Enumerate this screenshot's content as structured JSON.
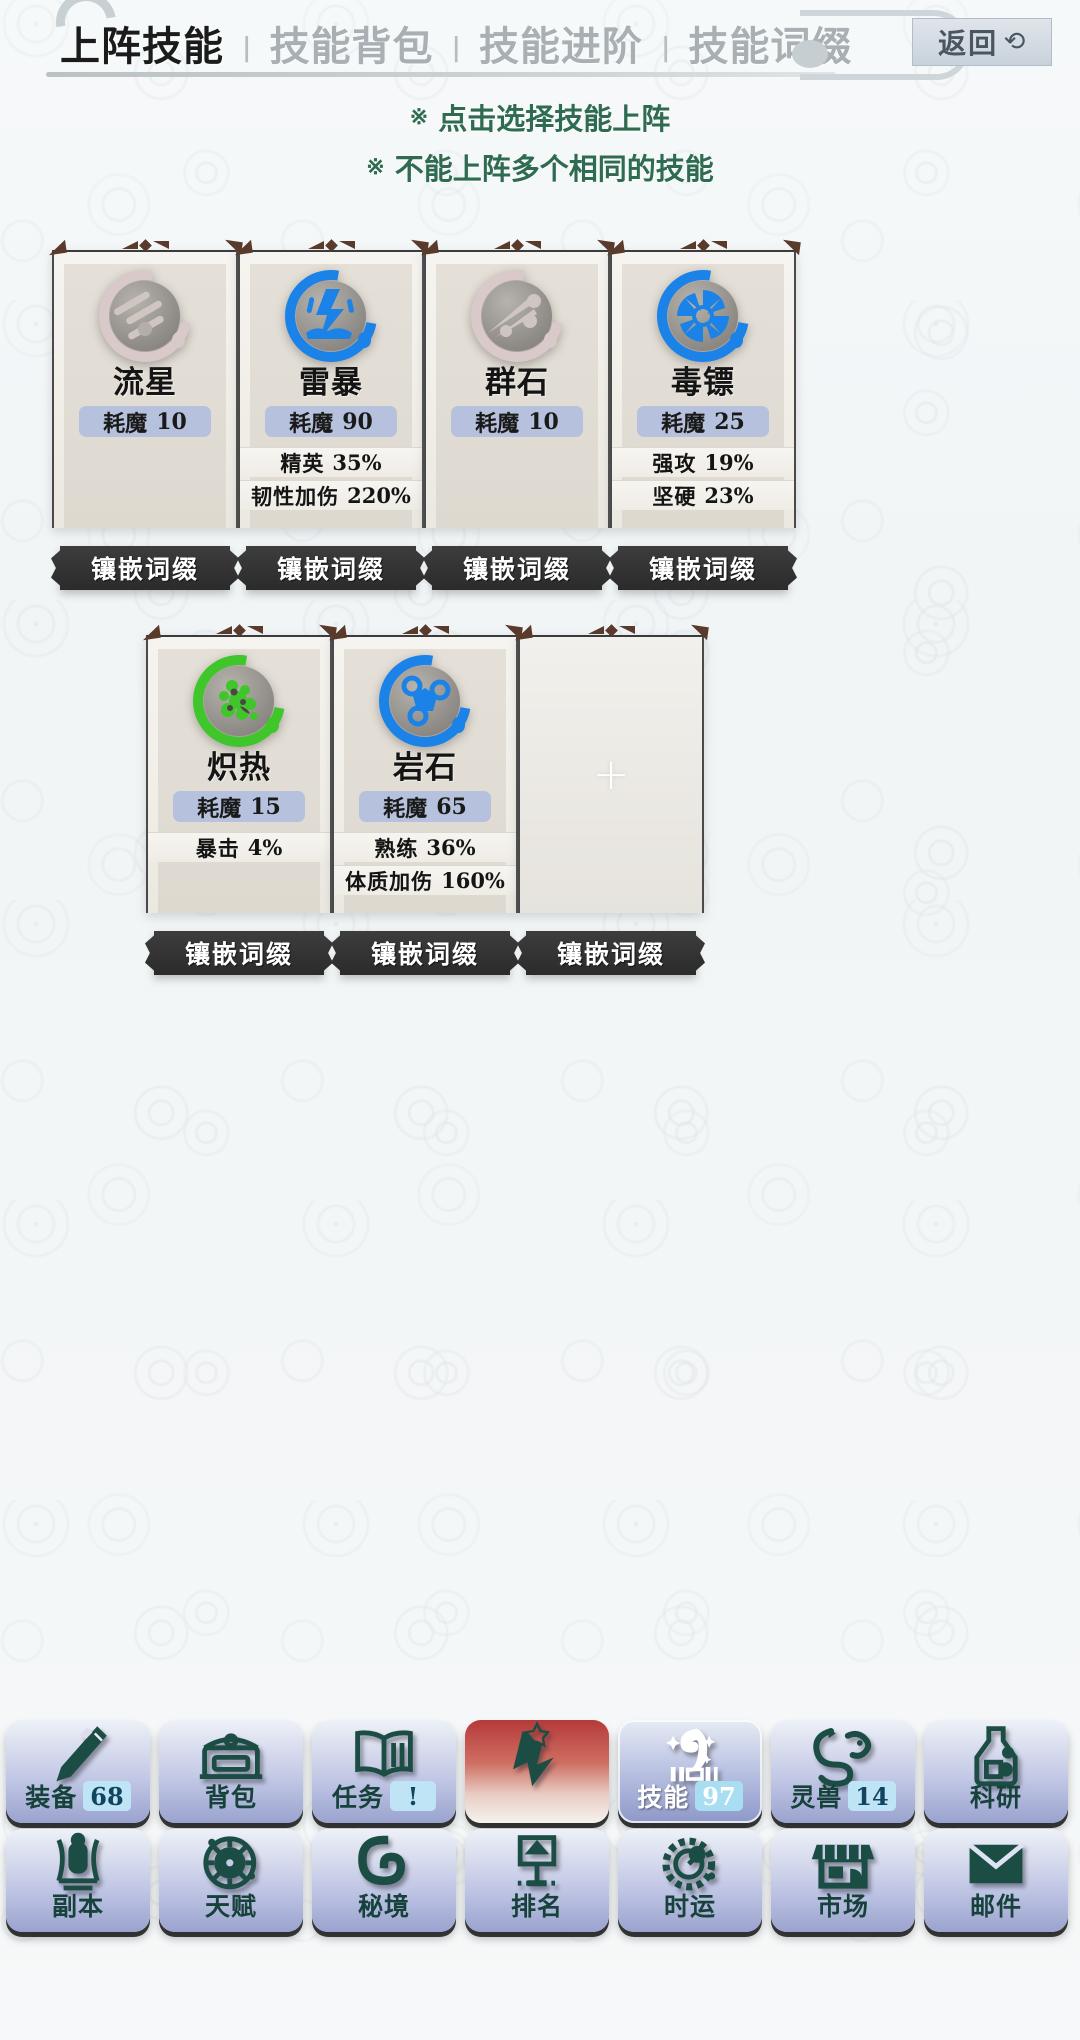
{
  "header": {
    "tabs": [
      {
        "label": "上阵技能",
        "active": true
      },
      {
        "label": "技能背包",
        "active": false
      },
      {
        "label": "技能进阶",
        "active": false
      },
      {
        "label": "技能词缀",
        "active": false
      }
    ],
    "separator": "|",
    "back_button": {
      "label": "返回",
      "icon": "back-arrow-icon",
      "glyph": "⟳"
    }
  },
  "hints": [
    {
      "mark": "※",
      "text": "点击选择技能上阵"
    },
    {
      "mark": "※",
      "text": "不能上阵多个相同的技能"
    }
  ],
  "affix_button_label": "镶嵌词缀",
  "mp_label": "耗魔",
  "empty_slot_glyph": "+",
  "colors": {
    "ring_blue": "#1b82e8",
    "ring_green": "#3fc62b",
    "ring_grey": "#d9c9c9",
    "mp_pill": "#b6c2dd",
    "hint_green": "#2e6b50",
    "nav_icon": "#1b4d45",
    "badge_bg": "#bfe4f5"
  },
  "skills": [
    {
      "name": "流星",
      "mp": "10",
      "ring": "grey",
      "icon": "meteor-icon",
      "equipped": false,
      "affixes": []
    },
    {
      "name": "雷暴",
      "mp": "90",
      "ring": "blue",
      "icon": "thunderstorm-icon",
      "equipped": true,
      "affixes": [
        {
          "name": "精英",
          "value": "35%"
        },
        {
          "name": "韧性加伤",
          "value": "220%"
        }
      ]
    },
    {
      "name": "群石",
      "mp": "10",
      "ring": "grey",
      "icon": "stone-cluster-icon",
      "equipped": false,
      "affixes": []
    },
    {
      "name": "毒镖",
      "mp": "25",
      "ring": "blue",
      "icon": "poison-dart-icon",
      "equipped": true,
      "affixes": [
        {
          "name": "强攻",
          "value": "19%"
        },
        {
          "name": "坚硬",
          "value": "23%"
        }
      ]
    },
    {
      "name": "炽热",
      "mp": "15",
      "ring": "green",
      "icon": "scorch-icon",
      "equipped": true,
      "affixes": [
        {
          "name": "暴击",
          "value": "4%"
        }
      ]
    },
    {
      "name": "岩石",
      "mp": "65",
      "ring": "blue",
      "icon": "rock-icon",
      "equipped": true,
      "affixes": [
        {
          "name": "熟练",
          "value": "36%"
        },
        {
          "name": "体质加伤",
          "value": "160%"
        }
      ]
    },
    {
      "name": "",
      "mp": "",
      "ring": "none",
      "icon": "empty-slot-icon",
      "empty": true,
      "affixes": []
    }
  ],
  "bottom_nav": {
    "row1": [
      {
        "label": "装备",
        "badge": "68",
        "icon": "weapon-icon",
        "style": "normal"
      },
      {
        "label": "背包",
        "badge": "",
        "icon": "chest-icon",
        "style": "normal"
      },
      {
        "label": "任务",
        "badge": "!",
        "icon": "book-icon",
        "style": "normal"
      },
      {
        "label": "",
        "badge": "",
        "icon": "wizard-banner-icon",
        "style": "featured"
      },
      {
        "label": "技能",
        "badge": "97",
        "icon": "skill-scroll-icon",
        "style": "selected"
      },
      {
        "label": "灵兽",
        "badge": "14",
        "icon": "spirit-beast-icon",
        "style": "normal"
      },
      {
        "label": "科研",
        "badge": "",
        "icon": "flask-icon",
        "style": "normal"
      }
    ],
    "row2": [
      {
        "label": "副本",
        "badge": "",
        "icon": "dungeon-icon",
        "style": "normal"
      },
      {
        "label": "天赋",
        "badge": "",
        "icon": "talent-icon",
        "style": "normal"
      },
      {
        "label": "秘境",
        "badge": "",
        "icon": "secret-realm-icon",
        "style": "normal"
      },
      {
        "label": "排名",
        "badge": "",
        "icon": "ranking-icon",
        "style": "normal"
      },
      {
        "label": "时运",
        "badge": "",
        "icon": "fortune-icon",
        "style": "normal"
      },
      {
        "label": "市场",
        "badge": "",
        "icon": "market-icon",
        "style": "normal"
      },
      {
        "label": "邮件",
        "badge": "",
        "icon": "mail-icon",
        "style": "normal"
      }
    ]
  }
}
